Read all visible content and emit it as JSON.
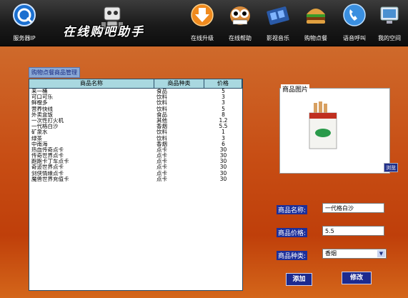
{
  "toolbar": {
    "service_label": "服务器IP",
    "brand_title": "在线购吧助手",
    "items": [
      {
        "label": "在线升级",
        "icon": "download-arrow-icon"
      },
      {
        "label": "在线帮助",
        "icon": "owl-help-icon"
      },
      {
        "label": "影视音乐",
        "icon": "film-reel-icon"
      },
      {
        "label": "购物点餐",
        "icon": "burger-icon"
      },
      {
        "label": "语音呼叫",
        "icon": "voice-call-icon"
      },
      {
        "label": "我的空间",
        "icon": "my-space-icon"
      }
    ]
  },
  "panel": {
    "title": "购物点餐商品管理",
    "columns": [
      "商品名称",
      "商品种类",
      "价格"
    ],
    "rows": [
      [
        "来一桶",
        "食品",
        "5"
      ],
      [
        "可口可乐",
        "饮料",
        "3"
      ],
      [
        "鲜橙多",
        "饮料",
        "3"
      ],
      [
        "营养快线",
        "饮料",
        "5"
      ],
      [
        "外卖盒饭",
        "食品",
        "8"
      ],
      [
        "一次性打火机",
        "其他",
        "1.2"
      ],
      [
        "一代格白沙",
        "香烟",
        "5.5"
      ],
      [
        "矿泉水",
        "饮料",
        "1"
      ],
      [
        "绿茶",
        "饮料",
        "3"
      ],
      [
        "中南海",
        "香烟",
        "6"
      ],
      [
        "热血传奇点卡",
        "点卡",
        "30"
      ],
      [
        "传奇世界点卡",
        "点卡",
        "30"
      ],
      [
        "跑跑卡丁车点卡",
        "点卡",
        "30"
      ],
      [
        "奇迹世界点卡",
        "点卡",
        "30"
      ],
      [
        "剑侠情缘点卡",
        "点卡",
        "30"
      ],
      [
        "魔兽世界充值卡",
        "点卡",
        "30"
      ]
    ]
  },
  "picture": {
    "label": "商品图片",
    "browse_label": "浏览"
  },
  "form": {
    "name_label": "商品名称:",
    "name_value": "一代格白沙",
    "price_label": "商品价格:",
    "price_value": "5.5",
    "category_label": "商品种类:",
    "category_value": "香烟"
  },
  "actions": {
    "add_label": "添加",
    "edit_label": "修改"
  }
}
